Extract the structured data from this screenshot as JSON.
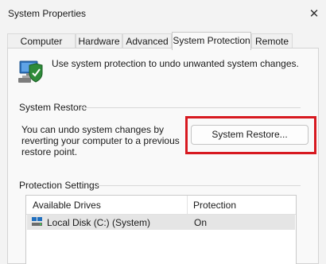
{
  "window": {
    "title": "System Properties",
    "close_glyph": "✕"
  },
  "tabs": [
    {
      "label": "Computer Name",
      "active": false
    },
    {
      "label": "Hardware",
      "active": false
    },
    {
      "label": "Advanced",
      "active": false
    },
    {
      "label": "System Protection",
      "active": true
    },
    {
      "label": "Remote",
      "active": false
    }
  ],
  "intro": {
    "text": "Use system protection to undo unwanted system changes.",
    "icon": "system-protection-icon"
  },
  "system_restore": {
    "group_label": "System Restore",
    "description": "You can undo system changes by reverting your computer to a previous restore point.",
    "button_label": "System Restore...",
    "highlight_color": "#d71920"
  },
  "protection_settings": {
    "group_label": "Protection Settings",
    "columns": [
      "Available Drives",
      "Protection"
    ],
    "rows": [
      {
        "drive": "Local Disk (C:) (System)",
        "protection": "On",
        "icon": "drive-icon"
      }
    ]
  }
}
